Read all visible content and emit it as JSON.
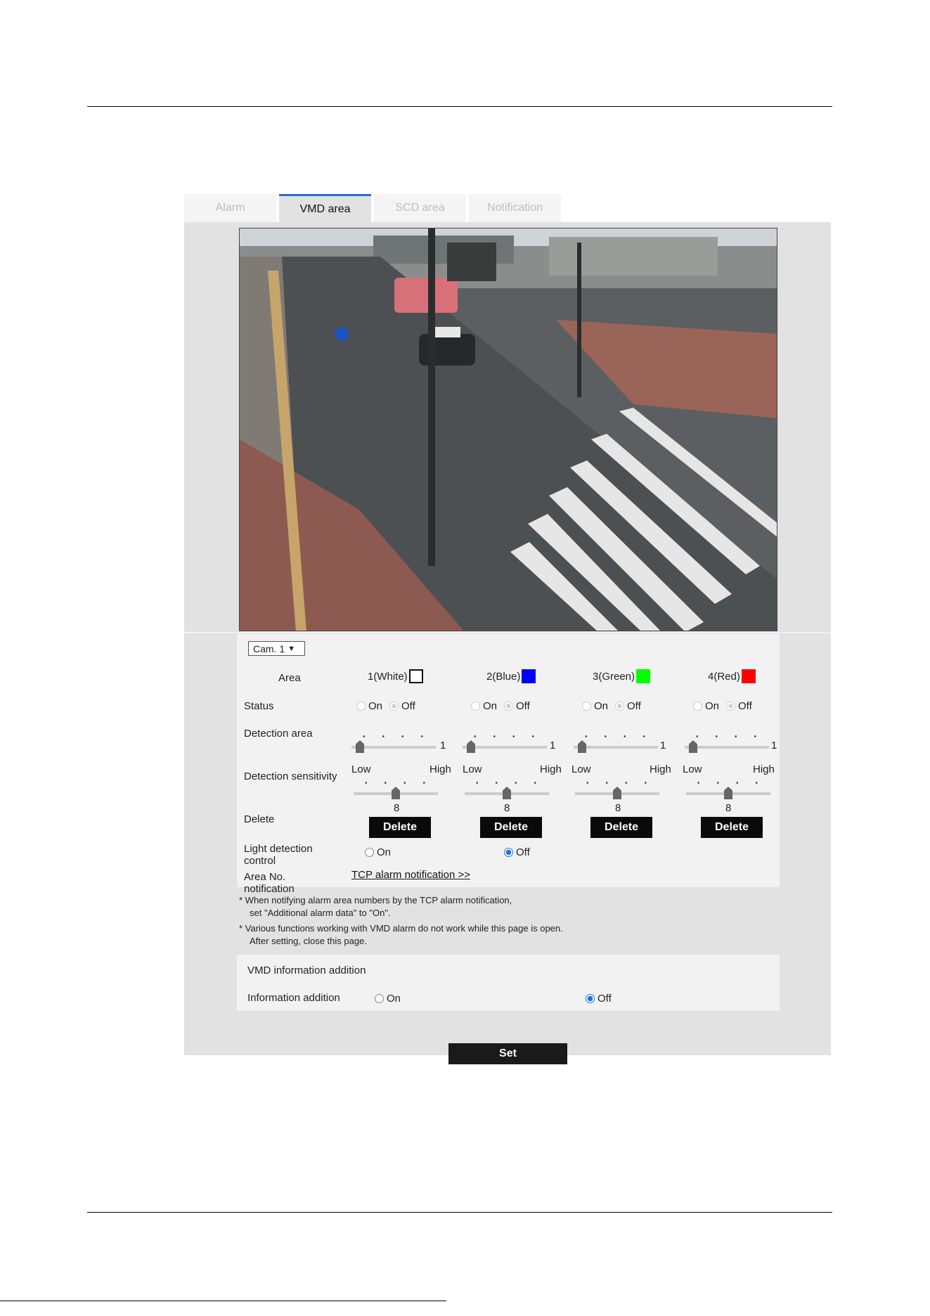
{
  "tabs": [
    {
      "label": "Alarm",
      "active": false
    },
    {
      "label": "VMD area",
      "active": true
    },
    {
      "label": "SCD area",
      "active": false
    },
    {
      "label": "Notification",
      "active": false
    }
  ],
  "camera_select": {
    "value": "Cam. 1"
  },
  "labels": {
    "area": "Area",
    "status": "Status",
    "detection_area": "Detection area",
    "detection_sensitivity": "Detection sensitivity",
    "delete": "Delete",
    "light_detection_line1": "Light detection",
    "light_detection_line2": "control",
    "area_no_line1": "Area No.",
    "area_no_line2": "notification",
    "on": "On",
    "off": "Off",
    "low": "Low",
    "high": "High"
  },
  "areas": [
    {
      "name": "1(White)",
      "color": "#ffffff",
      "status": "Off",
      "detection_area": "1",
      "sensitivity": "8",
      "delete_label": "Delete"
    },
    {
      "name": "2(Blue)",
      "color": "#0000ff",
      "status": "Off",
      "detection_area": "1",
      "sensitivity": "8",
      "delete_label": "Delete"
    },
    {
      "name": "3(Green)",
      "color": "#00ff00",
      "status": "Off",
      "detection_area": "1",
      "sensitivity": "8",
      "delete_label": "Delete"
    },
    {
      "name": "4(Red)",
      "color": "#ff0000",
      "status": "Off",
      "detection_area": "1",
      "sensitivity": "8",
      "delete_label": "Delete"
    }
  ],
  "sensitivity_scale": {
    "min": 1,
    "max": 10
  },
  "light_detection": {
    "selected": "Off"
  },
  "tcp_link": "TCP alarm notification >>",
  "notes": [
    "* When notifying alarm area numbers by the TCP alarm notification,",
    "set \"Additional alarm data\" to \"On\".",
    "* Various functions working with VMD alarm do not work while this page is open.",
    "After setting, close this page."
  ],
  "vmd_info": {
    "title": "VMD information addition",
    "label": "Information addition",
    "selected": "Off"
  },
  "set_label": "Set",
  "colors": {
    "accent": "#2f6ad6",
    "radio_selected": "#1a73e8"
  }
}
